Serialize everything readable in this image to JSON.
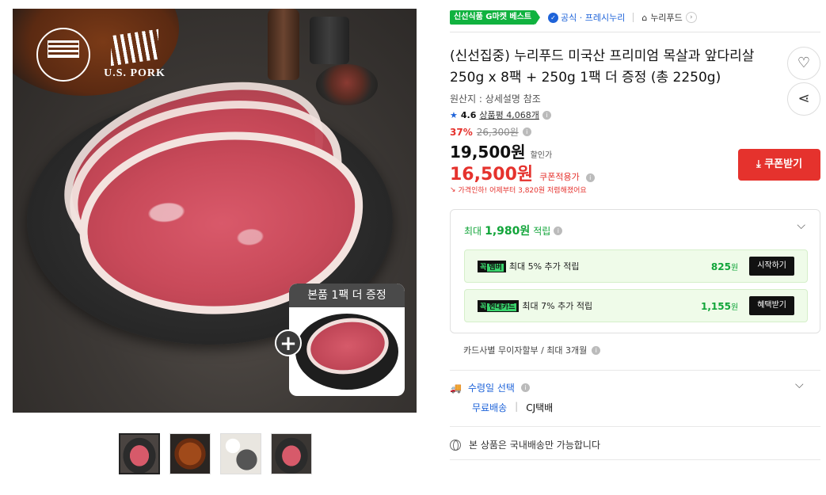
{
  "image": {
    "logo_usmeat": "U.S. MEAT EXPORT FEDERATION",
    "logo_uspork": "U.S. PORK",
    "bonus_label": "본품 1팩 더 증정",
    "plus": "+"
  },
  "thumbnails": [
    "thumb-1",
    "thumb-2",
    "thumb-3",
    "thumb-4"
  ],
  "badges": {
    "best": "신선식품 G마켓 베스트",
    "official": "공식 · 프레시누리",
    "seller": "누리푸드"
  },
  "product": {
    "title": "(신선집중) 누리푸드 미국산 프리미엄 목살과 앞다리살 250g x 8팩 + 250g 1팩 더 증정 (총 2250g)",
    "origin": "원산지 : 상세설명 참조",
    "rating_value": "4.6",
    "review_label": "상품평 4,068개",
    "discount_pct": "37%",
    "original_price": "26,300원",
    "sale_price": "19,500원",
    "sale_caption": "할인가",
    "coupon_price": "16,500원",
    "coupon_caption": "쿠폰적용가",
    "price_drop": "가격인하! 어제부터 3,820원 저렴해졌어요",
    "coupon_button": "쿠폰받기"
  },
  "reward": {
    "head_prefix": "최대",
    "head_amount": "1,980원",
    "head_suffix": "적립",
    "rows": [
      {
        "tag": "꼭",
        "tag2": "멤버",
        "text": "최대 5% 추가 적립",
        "amount": "825",
        "unit": "원",
        "button": "시작하기"
      },
      {
        "tag": "꼭",
        "tag2": "현대카드",
        "text": "최대 7% 추가 적립",
        "amount": "1,155",
        "unit": "원",
        "button": "혜택받기"
      }
    ]
  },
  "installment": "카드사별 무이자할부 / 최대 3개월",
  "shipping": {
    "title": "수령일 선택",
    "free": "무료배송",
    "carrier": "CJ택배"
  },
  "domestic": "본 상품은 국내배송만 가능합니다",
  "colors": {
    "accent_green": "#12a53a",
    "accent_red": "#e5322d",
    "accent_blue": "#1e63d9"
  }
}
